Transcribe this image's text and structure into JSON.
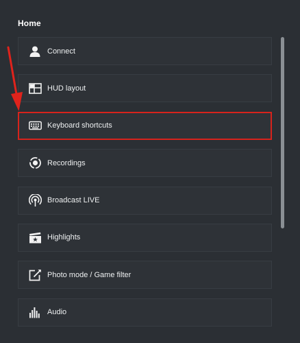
{
  "header": {
    "title": "Home"
  },
  "items": [
    {
      "label": "Connect",
      "icon": "person-icon"
    },
    {
      "label": "HUD layout",
      "icon": "hud-layout-icon"
    },
    {
      "label": "Keyboard shortcuts",
      "icon": "keyboard-icon"
    },
    {
      "label": "Recordings",
      "icon": "recordings-icon"
    },
    {
      "label": "Broadcast LIVE",
      "icon": "broadcast-icon"
    },
    {
      "label": "Highlights",
      "icon": "highlights-icon"
    },
    {
      "label": "Photo mode / Game filter",
      "icon": "photo-mode-icon"
    },
    {
      "label": "Audio",
      "icon": "audio-icon"
    }
  ],
  "selected_item": "Keyboard shortcuts",
  "colors": {
    "background": "#2b2f34",
    "item_background": "#2e3237",
    "highlight_border": "#d8231c",
    "annotation_arrow": "#e0231c"
  }
}
